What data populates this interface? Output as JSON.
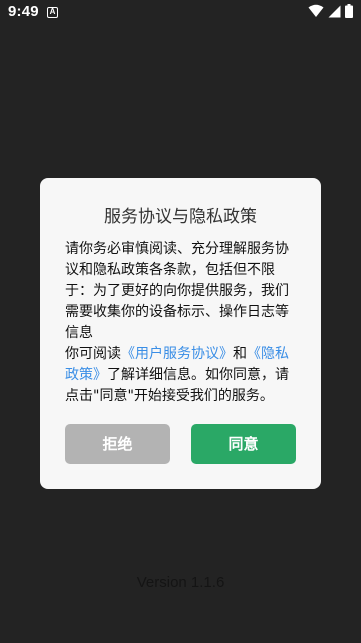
{
  "status_bar": {
    "time": "9:49",
    "notification_icon_letter": "A",
    "icons": [
      "wifi-icon",
      "cellular-signal-icon",
      "battery-icon"
    ]
  },
  "background": {
    "version_text": "Version 1.1.6"
  },
  "dialog": {
    "title": "服务协议与隐私政策",
    "paragraph1": "请你务必审慎阅读、充分理解服务协议和隐私政策各条款，包括但不限于：为了更好的向你提供服务，我们需要收集你的设备标示、操作日志等信息",
    "paragraph2": {
      "prefix": "你可阅读",
      "link_terms": "《用户服务协议》",
      "middle": "和",
      "link_privacy": "《隐私政策》",
      "suffix": "了解详细信息。如你同意，请点击\"同意\"开始接受我们的服务。"
    },
    "reject_label": "拒绝",
    "agree_label": "同意"
  },
  "colors": {
    "background": "#232323",
    "dialog_bg": "#f7f7f7",
    "link": "#3a8ee6",
    "reject_button": "#b3b3b3",
    "agree_button": "#2aa866"
  }
}
